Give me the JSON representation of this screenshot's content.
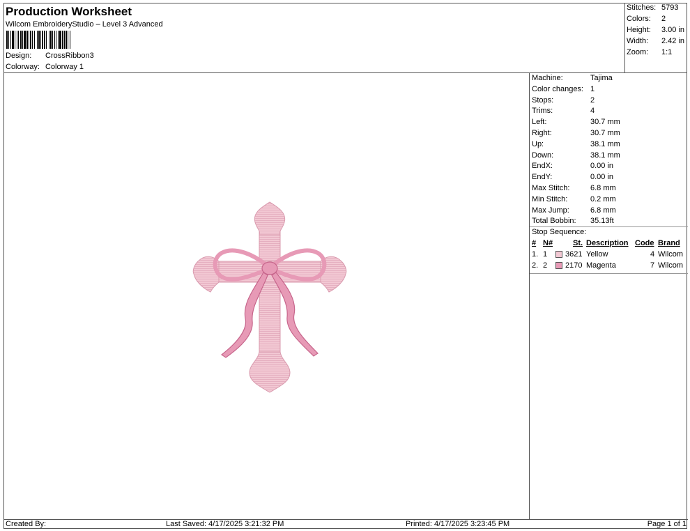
{
  "header": {
    "title": "Production Worksheet",
    "subtitle": "Wilcom EmbroideryStudio – Level 3 Advanced",
    "design_label": "Design:",
    "design_value": "CrossRibbon3",
    "colorway_label": "Colorway:",
    "colorway_value": "Colorway 1"
  },
  "summary": {
    "stitches_label": "Stitches:",
    "stitches_value": "5793",
    "colors_label": "Colors:",
    "colors_value": "2",
    "height_label": "Height:",
    "height_value": "3.00 in",
    "width_label": "Width:",
    "width_value": "2.42 in",
    "zoom_label": "Zoom:",
    "zoom_value": "1:1"
  },
  "machine_info": [
    {
      "label": "Machine:",
      "value": "Tajima"
    },
    {
      "label": "Color changes:",
      "value": "1"
    },
    {
      "label": "Stops:",
      "value": "2"
    },
    {
      "label": "Trims:",
      "value": "4"
    },
    {
      "label": "Left:",
      "value": "30.7 mm"
    },
    {
      "label": "Right:",
      "value": "30.7 mm"
    },
    {
      "label": "Up:",
      "value": "38.1 mm"
    },
    {
      "label": "Down:",
      "value": "38.1 mm"
    },
    {
      "label": "EndX:",
      "value": "0.00 in"
    },
    {
      "label": "EndY:",
      "value": "0.00 in"
    },
    {
      "label": "Max Stitch:",
      "value": "6.8 mm"
    },
    {
      "label": "Min Stitch:",
      "value": "0.2 mm"
    },
    {
      "label": "Max Jump:",
      "value": "6.8 mm"
    },
    {
      "label": "Total Bobbin:",
      "value": "35.13ft"
    }
  ],
  "stop_sequence": {
    "title": "Stop Sequence:",
    "headers": {
      "idx": "#",
      "n": "N#",
      "st": "St.",
      "description": "Description",
      "code": "Code",
      "brand": "Brand"
    },
    "rows": [
      {
        "idx": "1.",
        "n": "1",
        "color": "#f2c8d3",
        "st": "3621",
        "description": "Yellow",
        "code": "4",
        "brand": "Wilcom"
      },
      {
        "idx": "2.",
        "n": "2",
        "color": "#e79ab6",
        "st": "2170",
        "description": "Magenta",
        "code": "7",
        "brand": "Wilcom"
      }
    ]
  },
  "footer": {
    "created_by": "Created By:",
    "last_saved": "Last Saved: 4/17/2025 3:21:32 PM",
    "printed": "Printed: 4/17/2025 3:23:45 PM",
    "page": "Page 1 of 1"
  },
  "colors": {
    "cross_fill": "#f2c8d3",
    "ribbon_fill": "#e79ab6",
    "ribbon_stroke": "#c7668c"
  }
}
